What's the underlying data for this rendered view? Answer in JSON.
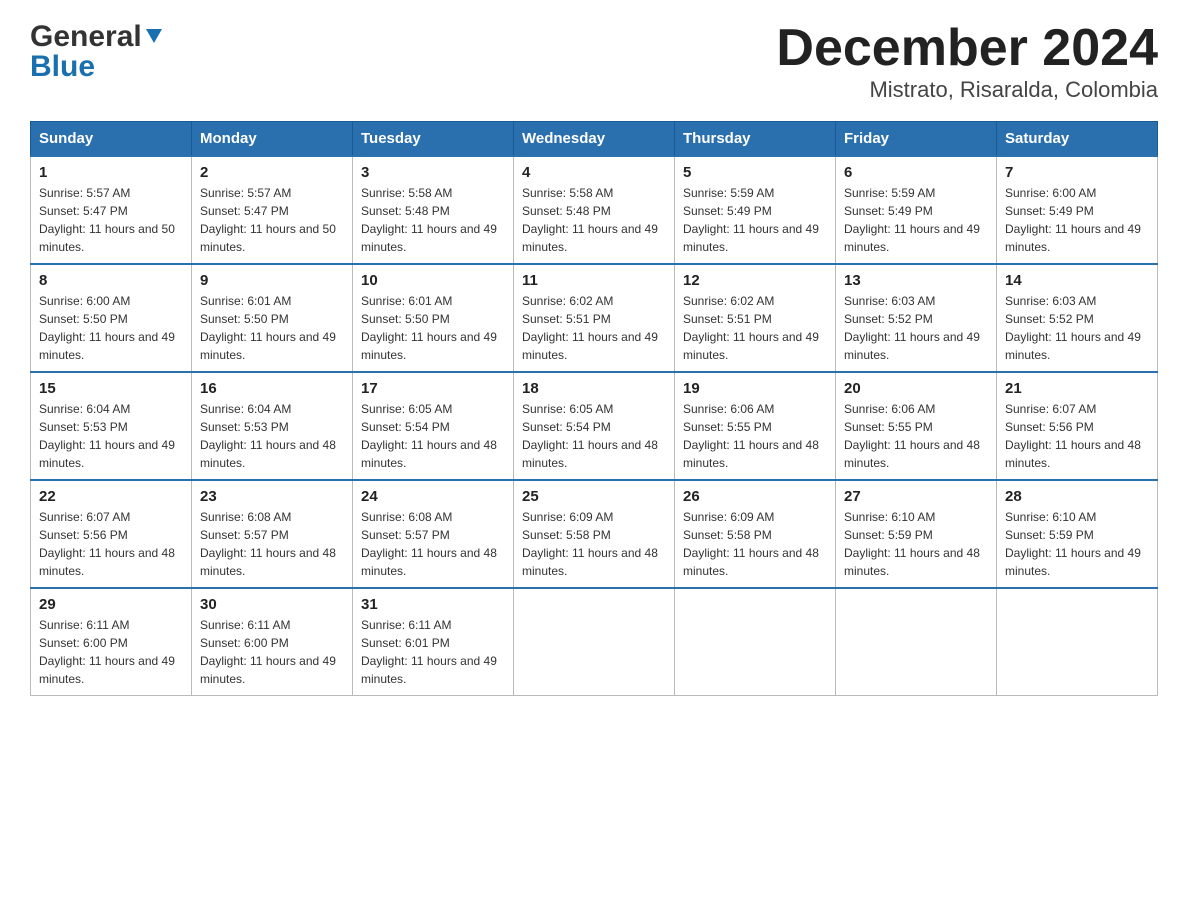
{
  "logo": {
    "general": "General",
    "blue": "Blue",
    "arrow": "▲"
  },
  "title": "December 2024",
  "subtitle": "Mistrato, Risaralda, Colombia",
  "days": [
    "Sunday",
    "Monday",
    "Tuesday",
    "Wednesday",
    "Thursday",
    "Friday",
    "Saturday"
  ],
  "weeks": [
    [
      {
        "num": "1",
        "sunrise": "5:57 AM",
        "sunset": "5:47 PM",
        "daylight": "11 hours and 50 minutes."
      },
      {
        "num": "2",
        "sunrise": "5:57 AM",
        "sunset": "5:47 PM",
        "daylight": "11 hours and 50 minutes."
      },
      {
        "num": "3",
        "sunrise": "5:58 AM",
        "sunset": "5:48 PM",
        "daylight": "11 hours and 49 minutes."
      },
      {
        "num": "4",
        "sunrise": "5:58 AM",
        "sunset": "5:48 PM",
        "daylight": "11 hours and 49 minutes."
      },
      {
        "num": "5",
        "sunrise": "5:59 AM",
        "sunset": "5:49 PM",
        "daylight": "11 hours and 49 minutes."
      },
      {
        "num": "6",
        "sunrise": "5:59 AM",
        "sunset": "5:49 PM",
        "daylight": "11 hours and 49 minutes."
      },
      {
        "num": "7",
        "sunrise": "6:00 AM",
        "sunset": "5:49 PM",
        "daylight": "11 hours and 49 minutes."
      }
    ],
    [
      {
        "num": "8",
        "sunrise": "6:00 AM",
        "sunset": "5:50 PM",
        "daylight": "11 hours and 49 minutes."
      },
      {
        "num": "9",
        "sunrise": "6:01 AM",
        "sunset": "5:50 PM",
        "daylight": "11 hours and 49 minutes."
      },
      {
        "num": "10",
        "sunrise": "6:01 AM",
        "sunset": "5:50 PM",
        "daylight": "11 hours and 49 minutes."
      },
      {
        "num": "11",
        "sunrise": "6:02 AM",
        "sunset": "5:51 PM",
        "daylight": "11 hours and 49 minutes."
      },
      {
        "num": "12",
        "sunrise": "6:02 AM",
        "sunset": "5:51 PM",
        "daylight": "11 hours and 49 minutes."
      },
      {
        "num": "13",
        "sunrise": "6:03 AM",
        "sunset": "5:52 PM",
        "daylight": "11 hours and 49 minutes."
      },
      {
        "num": "14",
        "sunrise": "6:03 AM",
        "sunset": "5:52 PM",
        "daylight": "11 hours and 49 minutes."
      }
    ],
    [
      {
        "num": "15",
        "sunrise": "6:04 AM",
        "sunset": "5:53 PM",
        "daylight": "11 hours and 49 minutes."
      },
      {
        "num": "16",
        "sunrise": "6:04 AM",
        "sunset": "5:53 PM",
        "daylight": "11 hours and 48 minutes."
      },
      {
        "num": "17",
        "sunrise": "6:05 AM",
        "sunset": "5:54 PM",
        "daylight": "11 hours and 48 minutes."
      },
      {
        "num": "18",
        "sunrise": "6:05 AM",
        "sunset": "5:54 PM",
        "daylight": "11 hours and 48 minutes."
      },
      {
        "num": "19",
        "sunrise": "6:06 AM",
        "sunset": "5:55 PM",
        "daylight": "11 hours and 48 minutes."
      },
      {
        "num": "20",
        "sunrise": "6:06 AM",
        "sunset": "5:55 PM",
        "daylight": "11 hours and 48 minutes."
      },
      {
        "num": "21",
        "sunrise": "6:07 AM",
        "sunset": "5:56 PM",
        "daylight": "11 hours and 48 minutes."
      }
    ],
    [
      {
        "num": "22",
        "sunrise": "6:07 AM",
        "sunset": "5:56 PM",
        "daylight": "11 hours and 48 minutes."
      },
      {
        "num": "23",
        "sunrise": "6:08 AM",
        "sunset": "5:57 PM",
        "daylight": "11 hours and 48 minutes."
      },
      {
        "num": "24",
        "sunrise": "6:08 AM",
        "sunset": "5:57 PM",
        "daylight": "11 hours and 48 minutes."
      },
      {
        "num": "25",
        "sunrise": "6:09 AM",
        "sunset": "5:58 PM",
        "daylight": "11 hours and 48 minutes."
      },
      {
        "num": "26",
        "sunrise": "6:09 AM",
        "sunset": "5:58 PM",
        "daylight": "11 hours and 48 minutes."
      },
      {
        "num": "27",
        "sunrise": "6:10 AM",
        "sunset": "5:59 PM",
        "daylight": "11 hours and 48 minutes."
      },
      {
        "num": "28",
        "sunrise": "6:10 AM",
        "sunset": "5:59 PM",
        "daylight": "11 hours and 49 minutes."
      }
    ],
    [
      {
        "num": "29",
        "sunrise": "6:11 AM",
        "sunset": "6:00 PM",
        "daylight": "11 hours and 49 minutes."
      },
      {
        "num": "30",
        "sunrise": "6:11 AM",
        "sunset": "6:00 PM",
        "daylight": "11 hours and 49 minutes."
      },
      {
        "num": "31",
        "sunrise": "6:11 AM",
        "sunset": "6:01 PM",
        "daylight": "11 hours and 49 minutes."
      },
      {
        "num": "",
        "sunrise": "",
        "sunset": "",
        "daylight": ""
      },
      {
        "num": "",
        "sunrise": "",
        "sunset": "",
        "daylight": ""
      },
      {
        "num": "",
        "sunrise": "",
        "sunset": "",
        "daylight": ""
      },
      {
        "num": "",
        "sunrise": "",
        "sunset": "",
        "daylight": ""
      }
    ]
  ],
  "labels": {
    "sunrise": "Sunrise:",
    "sunset": "Sunset:",
    "daylight": "Daylight:"
  }
}
